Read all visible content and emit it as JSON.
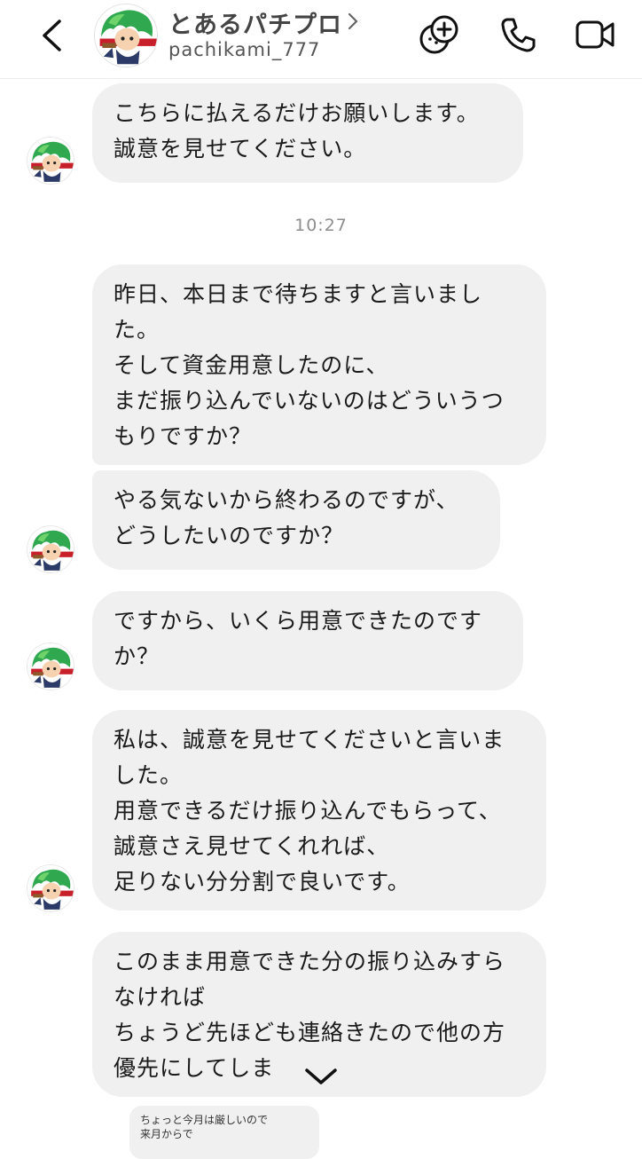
{
  "header": {
    "name": "とあるパチプロ",
    "username": "pachikami_777",
    "icons": [
      "back-chevron-icon",
      "avatar",
      "chevron-right-icon",
      "effects-icon",
      "phone-call-icon",
      "video-call-icon"
    ]
  },
  "timestamp": "10:27",
  "messages": [
    {
      "lines": [
        "こちらに払えるだけお願いします。",
        "誠意を見せてください。"
      ]
    },
    {
      "lines": [
        "昨日、本日まで待ちますと言いまし",
        "た。",
        "そして資金用意したのに、",
        "まだ振り込んでいないのはどういうつ",
        "もりですか？"
      ]
    },
    {
      "lines": [
        "やる気ないから終わるのですが、",
        "どうしたいのですか？"
      ]
    },
    {
      "lines": [
        "ですから、いくら用意できたのです",
        "か？"
      ]
    },
    {
      "lines": [
        "私は、誠意を見せてくださいと言いま",
        "した。",
        "用意できるだけ振り込んでもらって、",
        "誠意さえ見せてくれれば、",
        "足りない分分割で良いです。"
      ]
    },
    {
      "lines": [
        "このまま用意できた分の振り込みすら",
        "なければ",
        "ちょうど先ほども連絡きたので他の方",
        "優先にしてしま"
      ]
    }
  ],
  "reply_preview": {
    "lines": [
      "ちょっと今月は厳しいので",
      "来月からで"
    ]
  },
  "colors": {
    "bubble": "#f0f0f0",
    "header_name": "#444444",
    "timestamp": "#8e8e8e",
    "avatar_hair": "#2fa84f",
    "avatar_stripe": "#c8202a"
  }
}
